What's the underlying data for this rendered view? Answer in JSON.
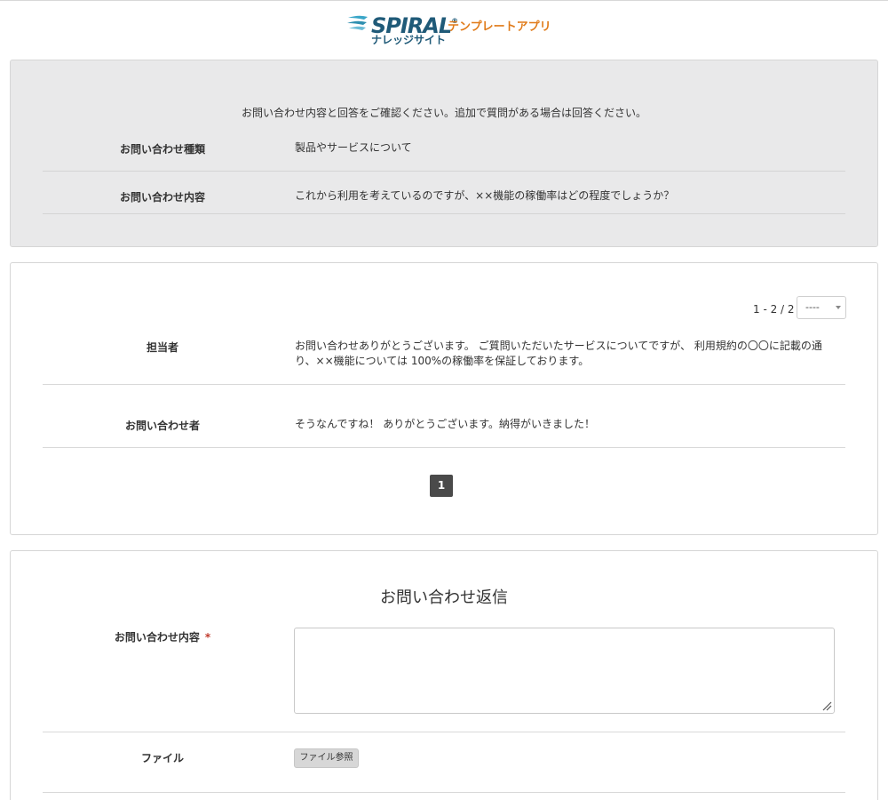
{
  "header": {
    "logo_brand": "SPIRAL",
    "logo_mark": "®",
    "logo_sub": "ナレッジサイト",
    "logo_app": "テンプレートアプリ"
  },
  "inquiry": {
    "notice": "お問い合わせ内容と回答をご確認ください。追加で質問がある場合は回答ください。",
    "type_label": "お問い合わせ種類",
    "type_value": "製品やサービスについて",
    "content_label": "お問い合わせ内容",
    "content_value": "これから利用を考えているのですが、××機能の稼働率はどの程度でしょうか？"
  },
  "thread": {
    "paging_text": "1 - 2 /  2",
    "page_size_value": "----",
    "messages": [
      {
        "sender": "担当者",
        "text_line1": "お問い合わせありがとうございます。 ご質問いただいたサービスについてですが、 利用規約の〇〇に記載の通",
        "text_line2": "り、××機能については 100%の稼働率を保証しております。"
      },
      {
        "sender": "お問い合わせ者",
        "text_line1": "そうなんですね！ ありがとうございます。納得がいきました！"
      }
    ],
    "current_page": "1"
  },
  "reply": {
    "title": "お問い合わせ返信",
    "content_label": "お問い合わせ内容",
    "required_mark": "*",
    "content_value": "",
    "file_label": "ファイル",
    "file_button": "ファイル参照"
  },
  "colors": {
    "brand_blue": "#1f5a78",
    "brand_orange": "#e07b1a",
    "panel_gray": "#e9e9ea",
    "required_red": "#c0392b"
  }
}
